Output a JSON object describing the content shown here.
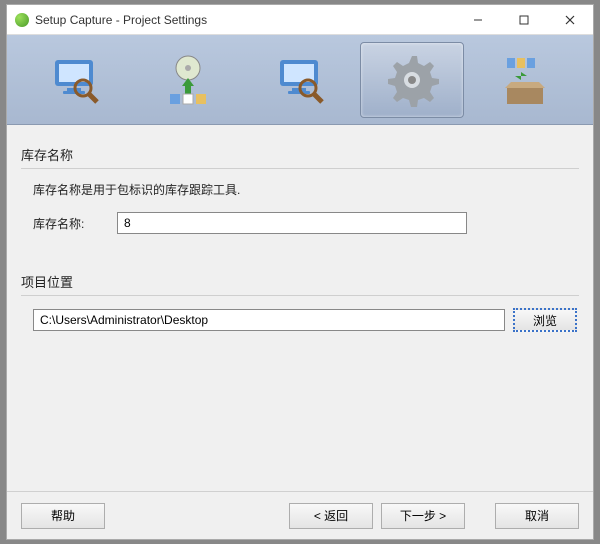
{
  "window": {
    "title": "Setup Capture - Project Settings"
  },
  "wizard_steps": [
    {
      "name": "initial-scan"
    },
    {
      "name": "install"
    },
    {
      "name": "post-scan"
    },
    {
      "name": "settings",
      "selected": true
    },
    {
      "name": "build"
    }
  ],
  "inventory": {
    "section_label": "库存名称",
    "description": "库存名称是用于包标识的库存跟踪工具.",
    "field_label": "库存名称:",
    "value": "8"
  },
  "location": {
    "section_label": "项目位置",
    "path": "C:\\Users\\Administrator\\Desktop",
    "browse_label": "浏览"
  },
  "buttons": {
    "help": "帮助",
    "back": "< 返回",
    "next": "下一步 >",
    "cancel": "取消"
  }
}
